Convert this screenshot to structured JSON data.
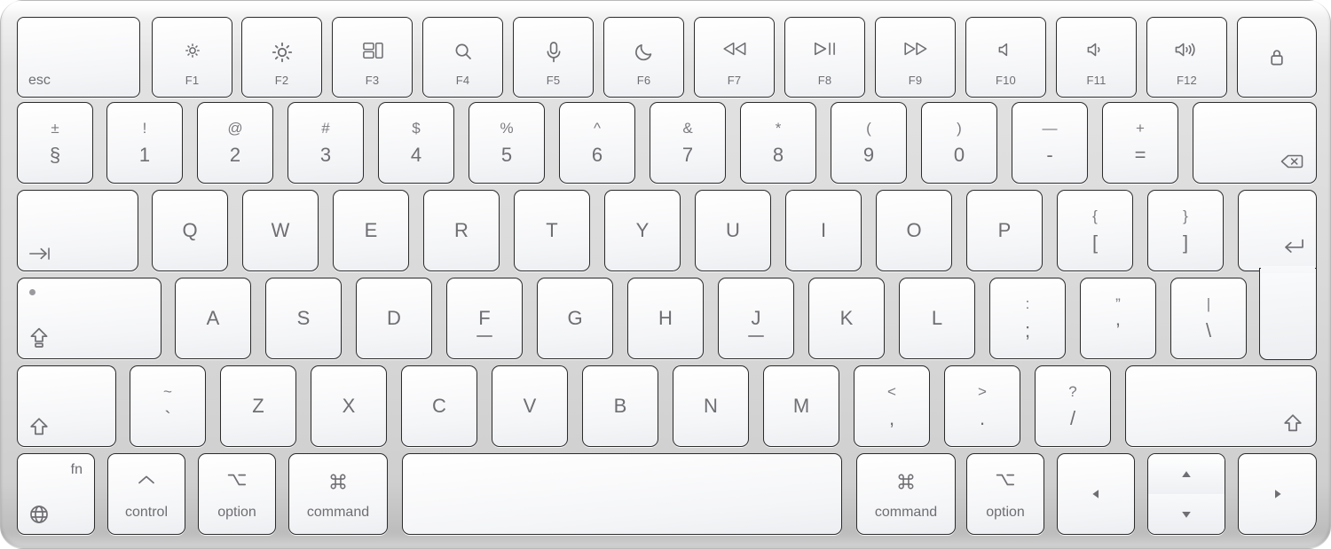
{
  "device": {
    "name": "Apple Magic Keyboard",
    "layout": "ISO (UK/International)",
    "body_color": "#d8d8d8",
    "key_color": "#f6f7f9",
    "legend_color": "#6e6e73"
  },
  "rows": {
    "function_row": [
      {
        "id": "esc",
        "main": "esc",
        "icon": null,
        "sub": null
      },
      {
        "id": "f1",
        "main": null,
        "icon": "brightness-down-icon",
        "sub": "F1"
      },
      {
        "id": "f2",
        "main": null,
        "icon": "brightness-up-icon",
        "sub": "F2"
      },
      {
        "id": "f3",
        "main": null,
        "icon": "mission-control-icon",
        "sub": "F3"
      },
      {
        "id": "f4",
        "main": null,
        "icon": "spotlight-search-icon",
        "sub": "F4"
      },
      {
        "id": "f5",
        "main": null,
        "icon": "dictation-microphone-icon",
        "sub": "F5"
      },
      {
        "id": "f6",
        "main": null,
        "icon": "do-not-disturb-moon-icon",
        "sub": "F6"
      },
      {
        "id": "f7",
        "main": null,
        "icon": "rewind-icon",
        "sub": "F7"
      },
      {
        "id": "f8",
        "main": null,
        "icon": "play-pause-icon",
        "sub": "F8"
      },
      {
        "id": "f9",
        "main": null,
        "icon": "fast-forward-icon",
        "sub": "F9"
      },
      {
        "id": "f10",
        "main": null,
        "icon": "mute-icon",
        "sub": "F10"
      },
      {
        "id": "f11",
        "main": null,
        "icon": "volume-down-icon",
        "sub": "F11"
      },
      {
        "id": "f12",
        "main": null,
        "icon": "volume-up-icon",
        "sub": "F12"
      },
      {
        "id": "lock",
        "main": null,
        "icon": "lock-icon",
        "sub": null
      }
    ],
    "number_row": [
      {
        "id": "section",
        "top": "±",
        "bottom": "§"
      },
      {
        "id": "1",
        "top": "!",
        "bottom": "1"
      },
      {
        "id": "2",
        "top": "@",
        "bottom": "2"
      },
      {
        "id": "3",
        "top": "#",
        "bottom": "3"
      },
      {
        "id": "4",
        "top": "$",
        "bottom": "4"
      },
      {
        "id": "5",
        "top": "%",
        "bottom": "5"
      },
      {
        "id": "6",
        "top": "^",
        "bottom": "6"
      },
      {
        "id": "7",
        "top": "&",
        "bottom": "7"
      },
      {
        "id": "8",
        "top": "*",
        "bottom": "8"
      },
      {
        "id": "9",
        "top": "(",
        "bottom": "9"
      },
      {
        "id": "0",
        "top": ")",
        "bottom": "0"
      },
      {
        "id": "minus",
        "top": "—",
        "bottom": "-"
      },
      {
        "id": "equal",
        "top": "+",
        "bottom": "="
      },
      {
        "id": "delete",
        "top": null,
        "bottom": null,
        "icon": "delete-backspace-icon"
      }
    ],
    "top_letter_row": [
      {
        "id": "tab",
        "icon": "tab-icon"
      },
      {
        "id": "q",
        "letter": "Q"
      },
      {
        "id": "w",
        "letter": "W"
      },
      {
        "id": "e",
        "letter": "E"
      },
      {
        "id": "r",
        "letter": "R"
      },
      {
        "id": "t",
        "letter": "T"
      },
      {
        "id": "y",
        "letter": "Y"
      },
      {
        "id": "u",
        "letter": "U"
      },
      {
        "id": "i",
        "letter": "I"
      },
      {
        "id": "o",
        "letter": "O"
      },
      {
        "id": "p",
        "letter": "P"
      },
      {
        "id": "bracketleft",
        "top": "{",
        "bottom": "["
      },
      {
        "id": "bracketright",
        "top": "}",
        "bottom": "]"
      },
      {
        "id": "return",
        "icon": "return-icon"
      }
    ],
    "home_row": [
      {
        "id": "capslock",
        "icon": "caps-lock-icon",
        "indicator": true
      },
      {
        "id": "a",
        "letter": "A"
      },
      {
        "id": "s",
        "letter": "S"
      },
      {
        "id": "d",
        "letter": "D"
      },
      {
        "id": "f",
        "letter": "F",
        "homing": true
      },
      {
        "id": "g",
        "letter": "G"
      },
      {
        "id": "h",
        "letter": "H"
      },
      {
        "id": "j",
        "letter": "J",
        "homing": true
      },
      {
        "id": "k",
        "letter": "K"
      },
      {
        "id": "l",
        "letter": "L"
      },
      {
        "id": "semicolon",
        "top": ":",
        "bottom": ";"
      },
      {
        "id": "quote",
        "top": "”",
        "bottom": "’"
      },
      {
        "id": "backslash",
        "top": "|",
        "bottom": "\\"
      }
    ],
    "bottom_letter_row": [
      {
        "id": "shift-left",
        "icon": "shift-icon"
      },
      {
        "id": "grave",
        "top": "~",
        "bottom": "`"
      },
      {
        "id": "z",
        "letter": "Z"
      },
      {
        "id": "x",
        "letter": "X"
      },
      {
        "id": "c",
        "letter": "C"
      },
      {
        "id": "v",
        "letter": "V"
      },
      {
        "id": "b",
        "letter": "B"
      },
      {
        "id": "n",
        "letter": "N"
      },
      {
        "id": "m",
        "letter": "M"
      },
      {
        "id": "comma",
        "top": "<",
        "bottom": ","
      },
      {
        "id": "period",
        "top": ">",
        "bottom": "."
      },
      {
        "id": "slash",
        "top": "?",
        "bottom": "/"
      },
      {
        "id": "shift-right",
        "icon": "shift-icon"
      }
    ],
    "modifier_row": [
      {
        "id": "fn",
        "label": "fn",
        "icon": "globe-icon"
      },
      {
        "id": "control-left",
        "label": "control",
        "icon": "control-caret-icon"
      },
      {
        "id": "option-left",
        "label": "option",
        "icon": "option-icon"
      },
      {
        "id": "command-left",
        "label": "command",
        "icon": "command-icon"
      },
      {
        "id": "space",
        "label": null,
        "icon": null
      },
      {
        "id": "command-right",
        "label": "command",
        "icon": "command-icon"
      },
      {
        "id": "option-right",
        "label": "option",
        "icon": "option-icon"
      },
      {
        "id": "arrow-left",
        "label": null,
        "icon": "arrow-left-icon"
      },
      {
        "id": "arrow-up",
        "label": null,
        "icon": "arrow-up-icon"
      },
      {
        "id": "arrow-down",
        "label": null,
        "icon": "arrow-down-icon"
      },
      {
        "id": "arrow-right",
        "label": null,
        "icon": "arrow-right-icon"
      }
    ]
  }
}
